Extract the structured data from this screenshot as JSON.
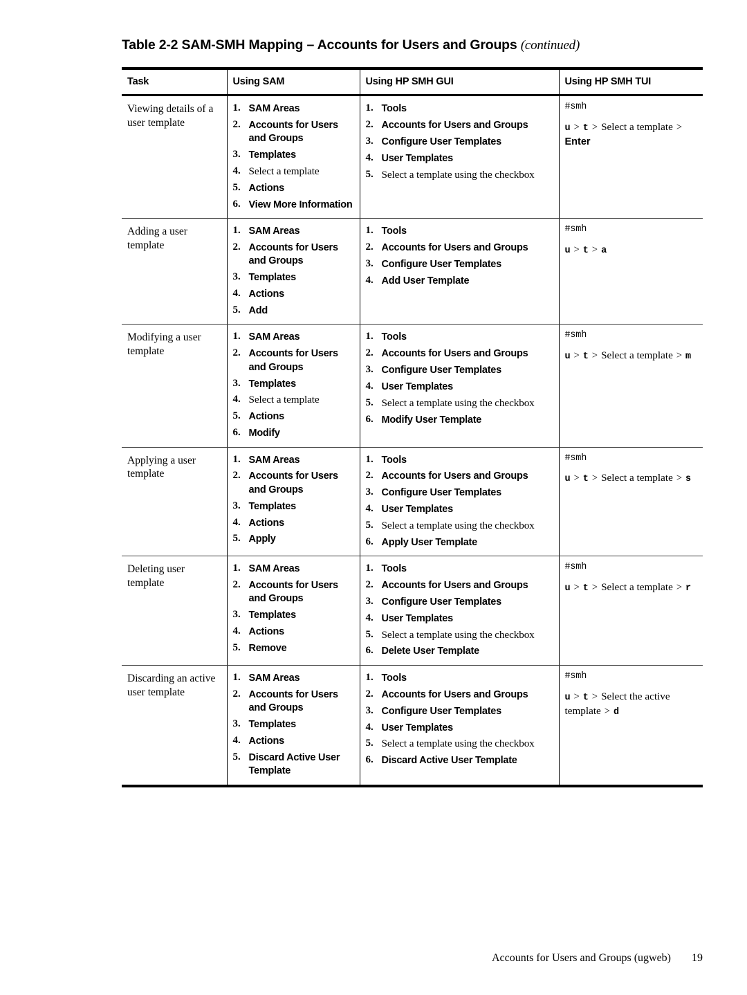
{
  "caption": {
    "main": "Table 2-2 SAM-SMH Mapping – Accounts for Users and Groups ",
    "continued": "(continued)"
  },
  "table": {
    "headers": {
      "task": "Task",
      "sam": "Using SAM",
      "gui": "Using HP SMH GUI",
      "tui": "Using HP SMH TUI"
    },
    "rows": [
      {
        "task": "Viewing details of a user template",
        "sam": [
          {
            "n": "1.",
            "text": "SAM Areas",
            "style": "ui"
          },
          {
            "n": "2.",
            "text": "Accounts for Users and Groups",
            "style": "ui"
          },
          {
            "n": "3.",
            "text": "Templates",
            "style": "ui"
          },
          {
            "n": "4.",
            "text": "Select a template",
            "style": "prose"
          },
          {
            "n": "5.",
            "text": "Actions",
            "style": "ui"
          },
          {
            "n": "6.",
            "text": "View More Information",
            "style": "ui"
          }
        ],
        "gui": [
          {
            "n": "1.",
            "text": "Tools",
            "style": "ui"
          },
          {
            "n": "2.",
            "text": "Accounts for Users and Groups",
            "style": "ui"
          },
          {
            "n": "3.",
            "text": "Configure User Templates",
            "style": "ui"
          },
          {
            "n": "4.",
            "text": "User Templates",
            "style": "ui"
          },
          {
            "n": "5.",
            "text": "Select a template using the checkbox",
            "style": "prose"
          }
        ],
        "tui": {
          "command": "#smh",
          "parts": [
            {
              "text": "u",
              "style": "key"
            },
            {
              "text": ">",
              "style": "gt"
            },
            {
              "text": "t",
              "style": "key"
            },
            {
              "text": ">",
              "style": "gt"
            },
            {
              "text": "Select a template",
              "style": "seq"
            },
            {
              "text": ">",
              "style": "gt"
            },
            {
              "text": "Enter",
              "style": "enter"
            }
          ]
        }
      },
      {
        "task": "Adding a user template",
        "sam": [
          {
            "n": "1.",
            "text": "SAM Areas",
            "style": "ui"
          },
          {
            "n": "2.",
            "text": "Accounts for Users and Groups",
            "style": "ui"
          },
          {
            "n": "3.",
            "text": "Templates",
            "style": "ui"
          },
          {
            "n": "4.",
            "text": "Actions",
            "style": "ui"
          },
          {
            "n": "5.",
            "text": "Add",
            "style": "ui"
          }
        ],
        "gui": [
          {
            "n": "1.",
            "text": "Tools",
            "style": "ui"
          },
          {
            "n": "2.",
            "text": "Accounts for Users and Groups",
            "style": "ui"
          },
          {
            "n": "3.",
            "text": "Configure User Templates",
            "style": "ui"
          },
          {
            "n": "4.",
            "text": "Add User Template",
            "style": "ui"
          }
        ],
        "tui": {
          "command": "#smh",
          "parts": [
            {
              "text": "u",
              "style": "key"
            },
            {
              "text": ">",
              "style": "gt"
            },
            {
              "text": "t",
              "style": "key"
            },
            {
              "text": ">",
              "style": "gt"
            },
            {
              "text": "a",
              "style": "key"
            }
          ]
        }
      },
      {
        "task": "Modifying a user template",
        "sam": [
          {
            "n": "1.",
            "text": "SAM Areas",
            "style": "ui"
          },
          {
            "n": "2.",
            "text": "Accounts for Users and Groups",
            "style": "ui"
          },
          {
            "n": "3.",
            "text": "Templates",
            "style": "ui"
          },
          {
            "n": "4.",
            "text": "Select a template",
            "style": "prose"
          },
          {
            "n": "5.",
            "text": "Actions",
            "style": "ui"
          },
          {
            "n": "6.",
            "text": "Modify",
            "style": "ui"
          }
        ],
        "gui": [
          {
            "n": "1.",
            "text": "Tools",
            "style": "ui"
          },
          {
            "n": "2.",
            "text": "Accounts for Users and Groups",
            "style": "ui"
          },
          {
            "n": "3.",
            "text": "Configure User Templates",
            "style": "ui"
          },
          {
            "n": "4.",
            "text": "User Templates",
            "style": "ui"
          },
          {
            "n": "5.",
            "text": "Select a template using the checkbox",
            "style": "prose"
          },
          {
            "n": "6.",
            "text": "Modify User Template",
            "style": "ui"
          }
        ],
        "tui": {
          "command": "#smh",
          "parts": [
            {
              "text": "u",
              "style": "key"
            },
            {
              "text": ">",
              "style": "gt"
            },
            {
              "text": "t",
              "style": "key"
            },
            {
              "text": ">",
              "style": "gt"
            },
            {
              "text": "Select a template",
              "style": "seq"
            },
            {
              "text": ">",
              "style": "gt"
            },
            {
              "text": "m",
              "style": "key"
            }
          ]
        }
      },
      {
        "task": "Applying a user template",
        "sam": [
          {
            "n": "1.",
            "text": "SAM Areas",
            "style": "ui"
          },
          {
            "n": "2.",
            "text": "Accounts for Users and Groups",
            "style": "ui"
          },
          {
            "n": "3.",
            "text": "Templates",
            "style": "ui"
          },
          {
            "n": "4.",
            "text": "Actions",
            "style": "ui"
          },
          {
            "n": "5.",
            "text": "Apply",
            "style": "ui"
          }
        ],
        "gui": [
          {
            "n": "1.",
            "text": "Tools",
            "style": "ui"
          },
          {
            "n": "2.",
            "text": "Accounts for Users and Groups",
            "style": "ui"
          },
          {
            "n": "3.",
            "text": "Configure User Templates",
            "style": "ui"
          },
          {
            "n": "4.",
            "text": "User Templates",
            "style": "ui"
          },
          {
            "n": "5.",
            "text": "Select a template using the checkbox",
            "style": "prose"
          },
          {
            "n": "6.",
            "text": "Apply User Template",
            "style": "ui"
          }
        ],
        "tui": {
          "command": "#smh",
          "parts": [
            {
              "text": "u",
              "style": "key"
            },
            {
              "text": ">",
              "style": "gt"
            },
            {
              "text": "t",
              "style": "key"
            },
            {
              "text": ">",
              "style": "gt"
            },
            {
              "text": "Select a template",
              "style": "seq"
            },
            {
              "text": ">",
              "style": "gt"
            },
            {
              "text": "s",
              "style": "key"
            }
          ]
        }
      },
      {
        "task": "Deleting user template",
        "sam": [
          {
            "n": "1.",
            "text": "SAM Areas",
            "style": "ui"
          },
          {
            "n": "2.",
            "text": "Accounts for Users and Groups",
            "style": "ui"
          },
          {
            "n": "3.",
            "text": "Templates",
            "style": "ui"
          },
          {
            "n": "4.",
            "text": "Actions",
            "style": "ui"
          },
          {
            "n": "5.",
            "text": "Remove",
            "style": "ui"
          }
        ],
        "gui": [
          {
            "n": "1.",
            "text": "Tools",
            "style": "ui"
          },
          {
            "n": "2.",
            "text": "Accounts for Users and Groups",
            "style": "ui"
          },
          {
            "n": "3.",
            "text": "Configure User Templates",
            "style": "ui"
          },
          {
            "n": "4.",
            "text": "User Templates",
            "style": "ui"
          },
          {
            "n": "5.",
            "text": "Select a template using the checkbox",
            "style": "prose"
          },
          {
            "n": "6.",
            "text": "Delete User Template",
            "style": "ui"
          }
        ],
        "tui": {
          "command": "#smh",
          "parts": [
            {
              "text": "u",
              "style": "key"
            },
            {
              "text": ">",
              "style": "gt"
            },
            {
              "text": "t",
              "style": "key"
            },
            {
              "text": ">",
              "style": "gt"
            },
            {
              "text": "Select a template",
              "style": "seq"
            },
            {
              "text": ">",
              "style": "gt"
            },
            {
              "text": "r",
              "style": "key"
            }
          ]
        }
      },
      {
        "task": "Discarding an active user template",
        "sam": [
          {
            "n": "1.",
            "text": "SAM Areas",
            "style": "ui"
          },
          {
            "n": "2.",
            "text": "Accounts for Users and Groups",
            "style": "ui"
          },
          {
            "n": "3.",
            "text": "Templates",
            "style": "ui"
          },
          {
            "n": "4.",
            "text": "Actions",
            "style": "ui"
          },
          {
            "n": "5.",
            "text": "Discard Active User Template",
            "style": "ui"
          }
        ],
        "gui": [
          {
            "n": "1.",
            "text": "Tools",
            "style": "ui"
          },
          {
            "n": "2.",
            "text": "Accounts for Users and Groups",
            "style": "ui"
          },
          {
            "n": "3.",
            "text": "Configure User Templates",
            "style": "ui"
          },
          {
            "n": "4.",
            "text": "User Templates",
            "style": "ui"
          },
          {
            "n": "5.",
            "text": "Select a template using the checkbox",
            "style": "prose"
          },
          {
            "n": "6.",
            "text": "Discard Active User Template",
            "style": "ui"
          }
        ],
        "tui": {
          "command": "#smh",
          "parts": [
            {
              "text": "u",
              "style": "key"
            },
            {
              "text": ">",
              "style": "gt"
            },
            {
              "text": "t",
              "style": "key"
            },
            {
              "text": ">",
              "style": "gt"
            },
            {
              "text": "Select the active template",
              "style": "seq"
            },
            {
              "text": ">",
              "style": "gt"
            },
            {
              "text": "d",
              "style": "key"
            }
          ]
        }
      }
    ]
  },
  "footer": {
    "text": "Accounts for Users and Groups (ugweb)",
    "page_number": "19"
  }
}
